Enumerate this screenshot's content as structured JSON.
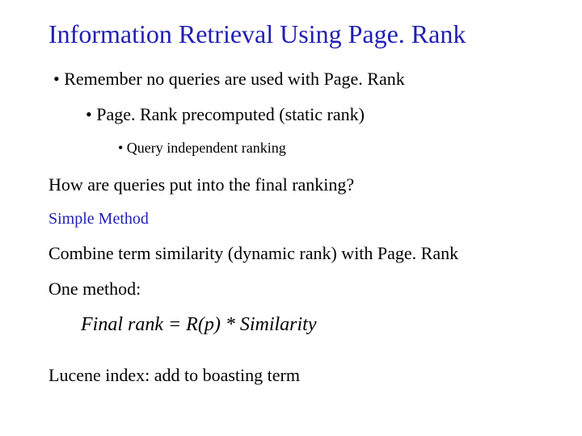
{
  "title": "Information Retrieval Using Page. Rank",
  "bullets": {
    "l1": "• Remember no queries are used with Page. Rank",
    "l2": "• Page. Rank precomputed (static rank)",
    "l3": "• Query independent ranking"
  },
  "question": "How are queries put into the final ranking?",
  "simple_method_label": "Simple Method",
  "combine_line": "Combine term similarity (dynamic rank) with Page. Rank",
  "one_method_label": "One method:",
  "formula": "Final rank = R(p) * Similarity",
  "lucene_line": "Lucene index: add to boasting term"
}
